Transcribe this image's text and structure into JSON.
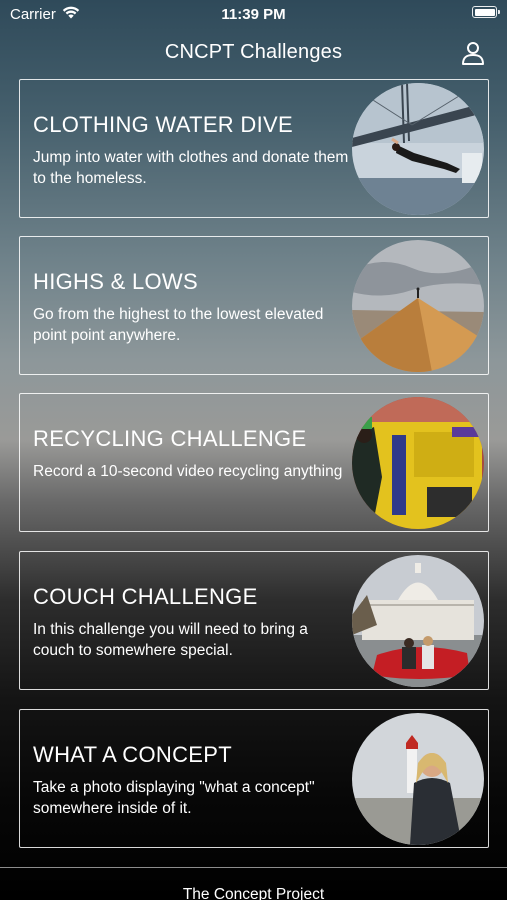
{
  "status_bar": {
    "carrier": "Carrier",
    "time": "11:39 PM",
    "icons": [
      "wifi-icon",
      "battery-icon"
    ]
  },
  "nav": {
    "title": "CNCPT Challenges",
    "profile_icon": "person-icon"
  },
  "challenges": [
    {
      "title": "CLOTHING WATER DIVE",
      "description": "Jump into water with clothes and donate them to the homeless."
    },
    {
      "title": "HIGHS & LOWS",
      "description": "Go from the highest to the lowest elevated point point anywhere."
    },
    {
      "title": "RECYCLING CHALLENGE",
      "description": "Record a 10-second video recycling anything"
    },
    {
      "title": "COUCH CHALLENGE",
      "description": "In this challenge you will need to bring a couch to somewhere special."
    },
    {
      "title": "WHAT A CONCEPT",
      "description": "Take a photo displaying \"what a concept\" somewhere inside of it."
    }
  ],
  "footer": {
    "text": "The Concept Project"
  }
}
